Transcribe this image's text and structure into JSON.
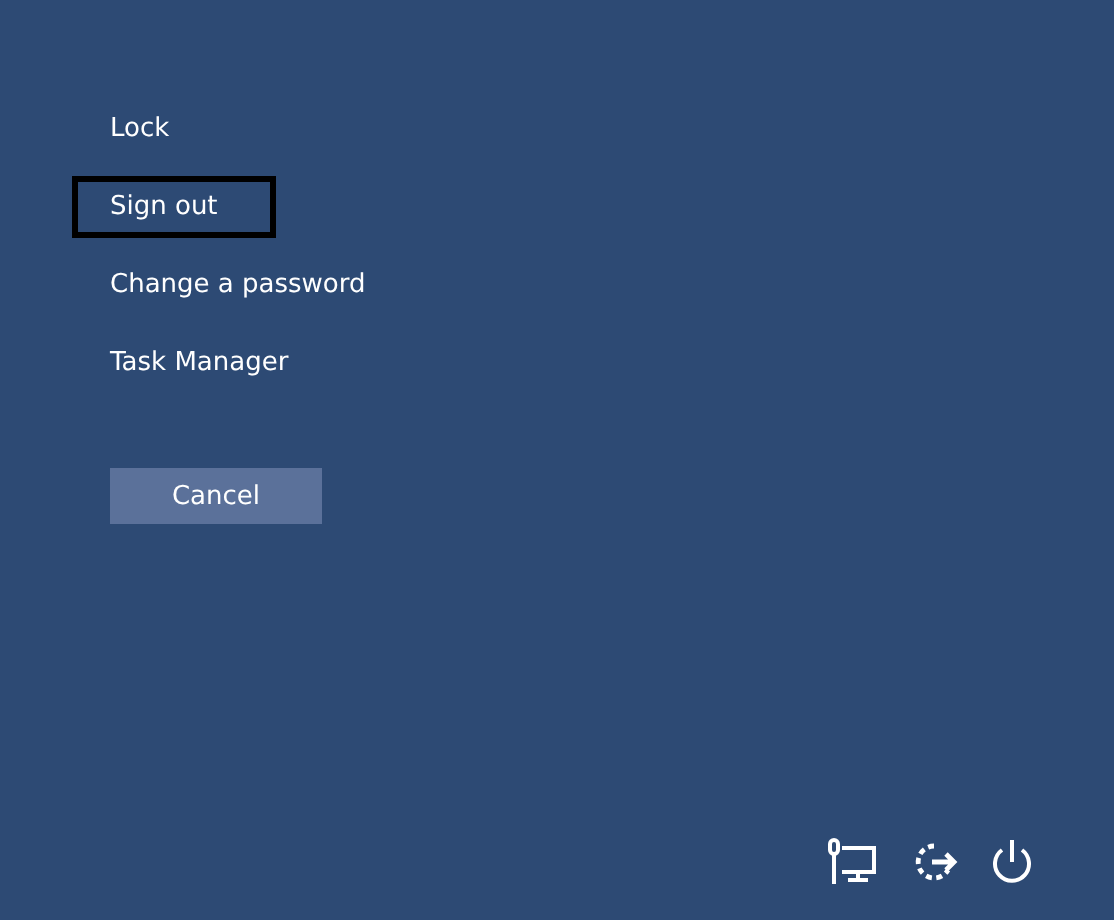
{
  "options": [
    {
      "label": "Lock",
      "selected": false
    },
    {
      "label": "Sign out",
      "selected": true
    },
    {
      "label": "Change a password",
      "selected": false
    },
    {
      "label": "Task Manager",
      "selected": false
    }
  ],
  "cancel_button": "Cancel"
}
